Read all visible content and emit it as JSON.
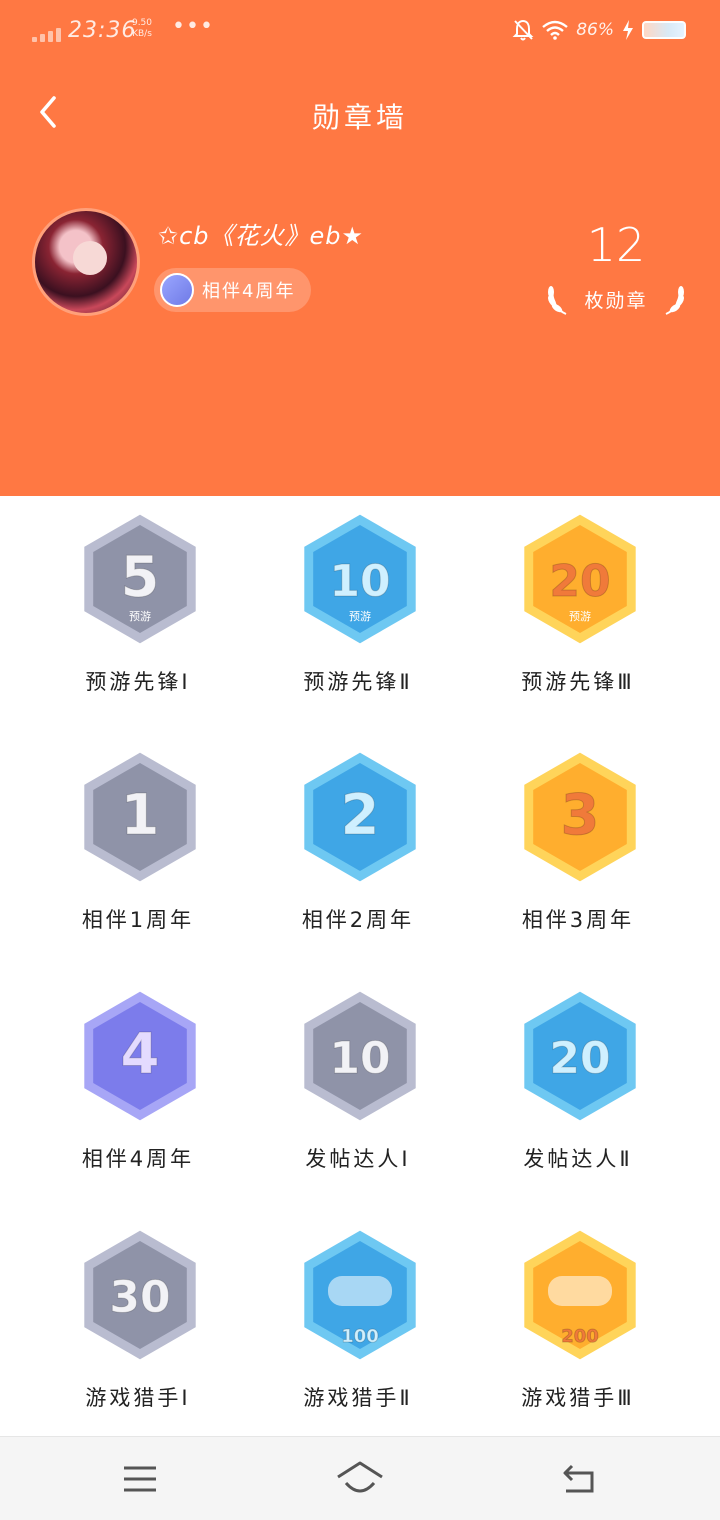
{
  "status_bar": {
    "time": "23:36",
    "net_speed_value": "9.50",
    "net_speed_unit": "KB/s",
    "more": "•••",
    "battery_percent": "86%"
  },
  "header": {
    "title": "勋章墙",
    "background_color": "#FF7843"
  },
  "profile": {
    "username": "✩cb《花火》eb★",
    "anniversary_chip": "相伴4周年",
    "badge_count": "12",
    "badge_count_label": "枚勋章"
  },
  "badges": [
    {
      "label": "预游先锋Ⅰ",
      "number": "5",
      "tier": "silver",
      "sub": "预游"
    },
    {
      "label": "预游先锋Ⅱ",
      "number": "10",
      "tier": "blue",
      "sub": "预游"
    },
    {
      "label": "预游先锋Ⅲ",
      "number": "20",
      "tier": "gold",
      "sub": "预游"
    },
    {
      "label": "相伴1周年",
      "number": "1",
      "tier": "silver",
      "sub": ""
    },
    {
      "label": "相伴2周年",
      "number": "2",
      "tier": "blue",
      "sub": ""
    },
    {
      "label": "相伴3周年",
      "number": "3",
      "tier": "gold",
      "sub": ""
    },
    {
      "label": "相伴4周年",
      "number": "4",
      "tier": "purple",
      "sub": ""
    },
    {
      "label": "发帖达人Ⅰ",
      "number": "10",
      "tier": "silver",
      "sub": ""
    },
    {
      "label": "发帖达人Ⅱ",
      "number": "20",
      "tier": "blue",
      "sub": ""
    },
    {
      "label": "游戏猎手Ⅰ",
      "number": "30",
      "tier": "silver",
      "sub": ""
    },
    {
      "label": "游戏猎手Ⅱ",
      "number": "100",
      "tier": "blue",
      "sub": ""
    },
    {
      "label": "游戏猎手Ⅲ",
      "number": "200",
      "tier": "gold",
      "sub": ""
    }
  ],
  "tier_colors": {
    "silver": {
      "outer": "#B9BCD0",
      "inner": "#8F93A8",
      "text": "#F2F2F6"
    },
    "blue": {
      "outer": "#6EC8F2",
      "inner": "#3FA6E6",
      "text": "#CFF0FF"
    },
    "gold": {
      "outer": "#FFD45A",
      "inner": "#FFAE2E",
      "text": "#F07A3A"
    },
    "purple": {
      "outer": "#A7A6F6",
      "inner": "#7C7CEB",
      "text": "#E4DBFF"
    }
  },
  "navbar": {
    "menu_icon": "menu-icon",
    "home_icon": "home-icon",
    "back_icon": "back-icon"
  }
}
